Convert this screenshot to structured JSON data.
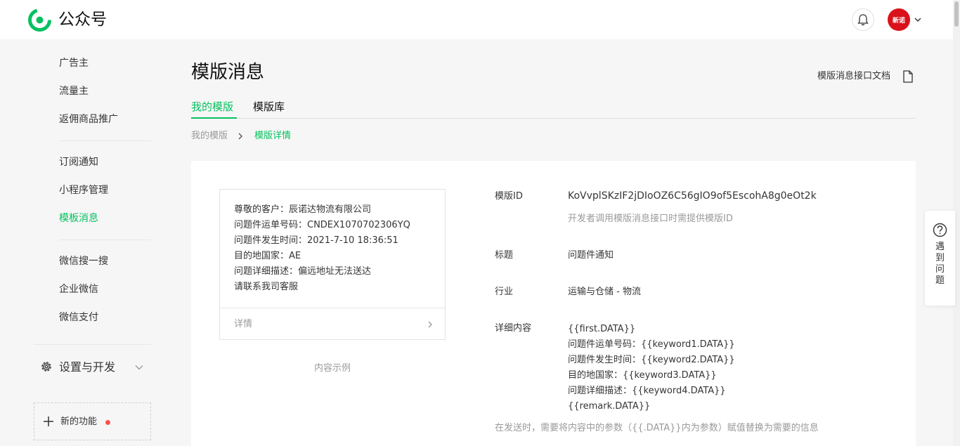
{
  "topbar": {
    "brand": "公众号",
    "avatar_text": "新诺"
  },
  "sidebar": {
    "items": [
      {
        "label": "广告主"
      },
      {
        "label": "流量主"
      },
      {
        "label": "返佣商品推广"
      },
      {
        "label": "订阅通知"
      },
      {
        "label": "小程序管理"
      },
      {
        "label": "模板消息",
        "active": true
      },
      {
        "label": "微信搜一搜"
      },
      {
        "label": "企业微信"
      },
      {
        "label": "微信支付"
      }
    ],
    "group_label": "设置与开发",
    "new_feature_label": "新的功能"
  },
  "page": {
    "title": "模版消息",
    "doc_link": "模版消息接口文档",
    "tabs": [
      {
        "label": "我的模版",
        "active": true
      },
      {
        "label": "模版库",
        "active": false
      }
    ],
    "breadcrumb": [
      "我的模版",
      "模版详情"
    ]
  },
  "preview": {
    "lines": [
      "尊敬的客户：辰诺达物流有限公司",
      "问题件运单号码：CNDEX1070702306YQ",
      "问题件发生时间：2021-7-10 18:36:51",
      "目的地国家：AE",
      "问题详细描述：偏远地址无法送达",
      "请联系我司客服"
    ],
    "detail_label": "详情",
    "caption": "内容示例"
  },
  "fields": {
    "template_id_label": "模版ID",
    "template_id_value": "KoVvplSKzIF2jDIoOZ6C56gIO9of5EscohA8g0eOt2k",
    "template_id_hint": "开发者调用模版消息接口时需提供模版ID",
    "title_label": "标题",
    "title_value": "问题件通知",
    "industry_label": "行业",
    "industry_value": "运输与仓储 - 物流",
    "content_label": "详细内容",
    "content_lines": [
      "{{first.DATA}}",
      "问题件运单号码：{{keyword1.DATA}}",
      "问题件发生时间：{{keyword2.DATA}}",
      "目的地国家：{{keyword3.DATA}}",
      "问题详细描述：{{keyword4.DATA}}",
      "{{remark.DATA}}"
    ],
    "footnote": "在发送时，需要将内容中的参数（{{.DATA}}内为参数）赋值替换为需要的信息"
  },
  "help": {
    "label": "遇到问题"
  },
  "colors": {
    "accent": "#07c160",
    "red_dot": "#fa5151",
    "avatar_bg": "#d9121b"
  }
}
